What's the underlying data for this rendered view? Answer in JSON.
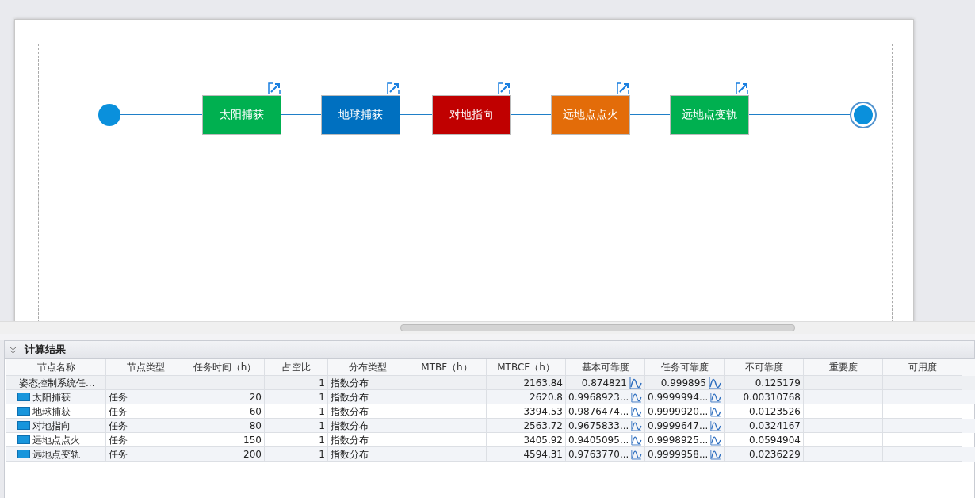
{
  "diagram": {
    "nodes": [
      {
        "label": "太阳捕获",
        "color": "#00b050"
      },
      {
        "label": "地球捕获",
        "color": "#0070c0"
      },
      {
        "label": "对地指向",
        "color": "#c00000"
      },
      {
        "label": "远地点点火",
        "color": "#e36c09"
      },
      {
        "label": "远地点变轨",
        "color": "#00b050"
      }
    ]
  },
  "panel": {
    "title": "计算结果",
    "columns": [
      "节点名称",
      "节点类型",
      "任务时间（h）",
      "占空比",
      "分布类型",
      "MTBF（h）",
      "MTBCF（h）",
      "基本可靠度",
      "任务可靠度",
      "不可靠度",
      "重要度",
      "可用度"
    ],
    "rows": [
      {
        "name": "姿态控制系统任...",
        "duty": "1",
        "dist": "指数分布",
        "mtbcf": "2163.84",
        "basic": "0.874821",
        "mission": "0.999895",
        "unrel": "0.125179",
        "children": [
          {
            "name": "太阳捕获",
            "type": "任务",
            "time": "20",
            "duty": "1",
            "dist": "指数分布",
            "mtbcf": "2620.8",
            "basic": "0.9968923...",
            "mission": "0.9999994...",
            "unrel": "0.00310768"
          },
          {
            "name": "地球捕获",
            "type": "任务",
            "time": "60",
            "duty": "1",
            "dist": "指数分布",
            "mtbcf": "3394.53",
            "basic": "0.9876474...",
            "mission": "0.9999920...",
            "unrel": "0.0123526"
          },
          {
            "name": "对地指向",
            "type": "任务",
            "time": "80",
            "duty": "1",
            "dist": "指数分布",
            "mtbcf": "2563.72",
            "basic": "0.9675833...",
            "mission": "0.9999647...",
            "unrel": "0.0324167"
          },
          {
            "name": "远地点点火",
            "type": "任务",
            "time": "150",
            "duty": "1",
            "dist": "指数分布",
            "mtbcf": "3405.92",
            "basic": "0.9405095...",
            "mission": "0.9998925...",
            "unrel": "0.0594904"
          },
          {
            "name": "远地点变轨",
            "type": "任务",
            "time": "200",
            "duty": "1",
            "dist": "指数分布",
            "mtbcf": "4594.31",
            "basic": "0.9763770...",
            "mission": "0.9999958...",
            "unrel": "0.0236229"
          }
        ]
      }
    ]
  }
}
